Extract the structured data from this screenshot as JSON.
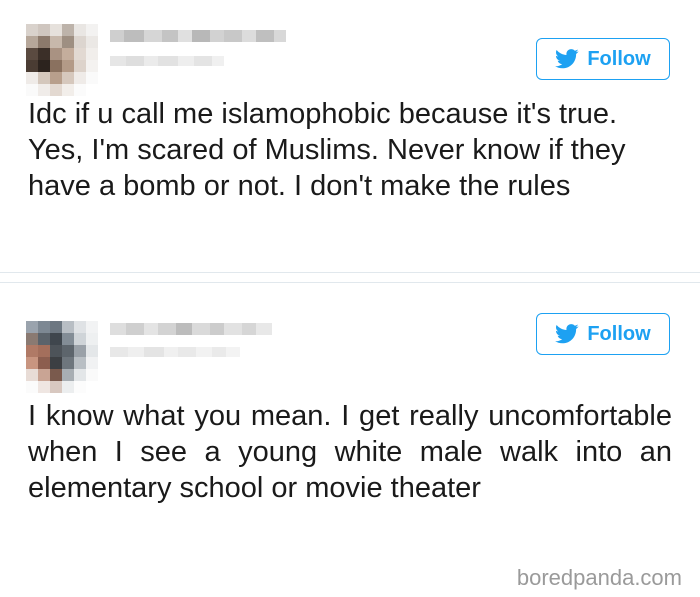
{
  "tweets": [
    {
      "author_name": "",
      "author_handle": "",
      "follow_label": "Follow",
      "text": "Idc if u call me islamophobic because it's true. Yes, I'm scared of Muslims. Never know if they have a bomb or not. I don't make the rules"
    },
    {
      "author_name": "",
      "author_handle": "",
      "follow_label": "Follow",
      "text": "I know what you mean. I get really uncomfortable when I see a young white male walk into an elementary school or movie theater"
    }
  ],
  "watermark": "boredpanda.com",
  "colors": {
    "accent": "#1da1f2",
    "text": "#1a1a1a",
    "divider": "#e1e8ed",
    "watermark": "#9a9a9a"
  },
  "icons": {
    "follow": "twitter-bird-icon"
  }
}
